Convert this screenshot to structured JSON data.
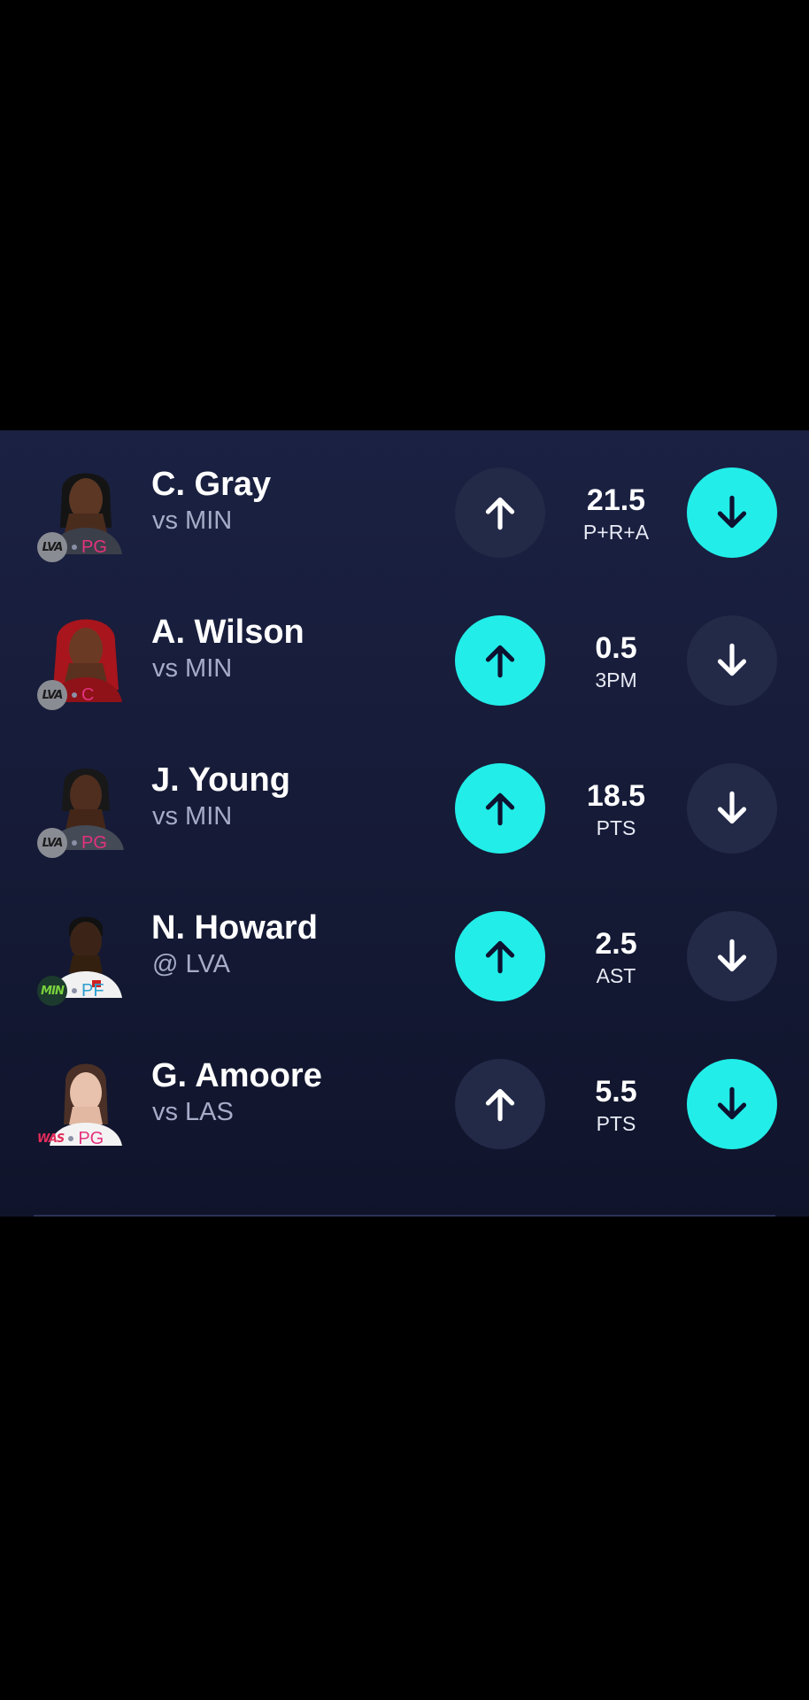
{
  "colors": {
    "background": "#000000",
    "panel": "#1b2142",
    "accent": "#22ede8",
    "inactive_button": "#232a48",
    "position_pink": "#e4327e",
    "position_blue": "#2c9fd0"
  },
  "players": [
    {
      "name": "C. Gray",
      "opponent": "vs MIN",
      "team": "LVA",
      "position": "PG",
      "line": "21.5",
      "stat": "P+R+A",
      "selected": "less"
    },
    {
      "name": "A. Wilson",
      "opponent": "vs MIN",
      "team": "LVA",
      "position": "C",
      "line": "0.5",
      "stat": "3PM",
      "selected": "more"
    },
    {
      "name": "J. Young",
      "opponent": "vs MIN",
      "team": "LVA",
      "position": "PG",
      "line": "18.5",
      "stat": "PTS",
      "selected": "more"
    },
    {
      "name": "N. Howard",
      "opponent": "@ LVA",
      "team": "MIN",
      "position": "PF",
      "line": "2.5",
      "stat": "AST",
      "selected": "more"
    },
    {
      "name": "G. Amoore",
      "opponent": "vs LAS",
      "team": "WAS",
      "position": "PG",
      "line": "5.5",
      "stat": "PTS",
      "selected": "less"
    }
  ],
  "icons": {
    "more": "arrow-up-icon",
    "less": "arrow-down-icon",
    "player_photo": "player-headshot-icon"
  }
}
